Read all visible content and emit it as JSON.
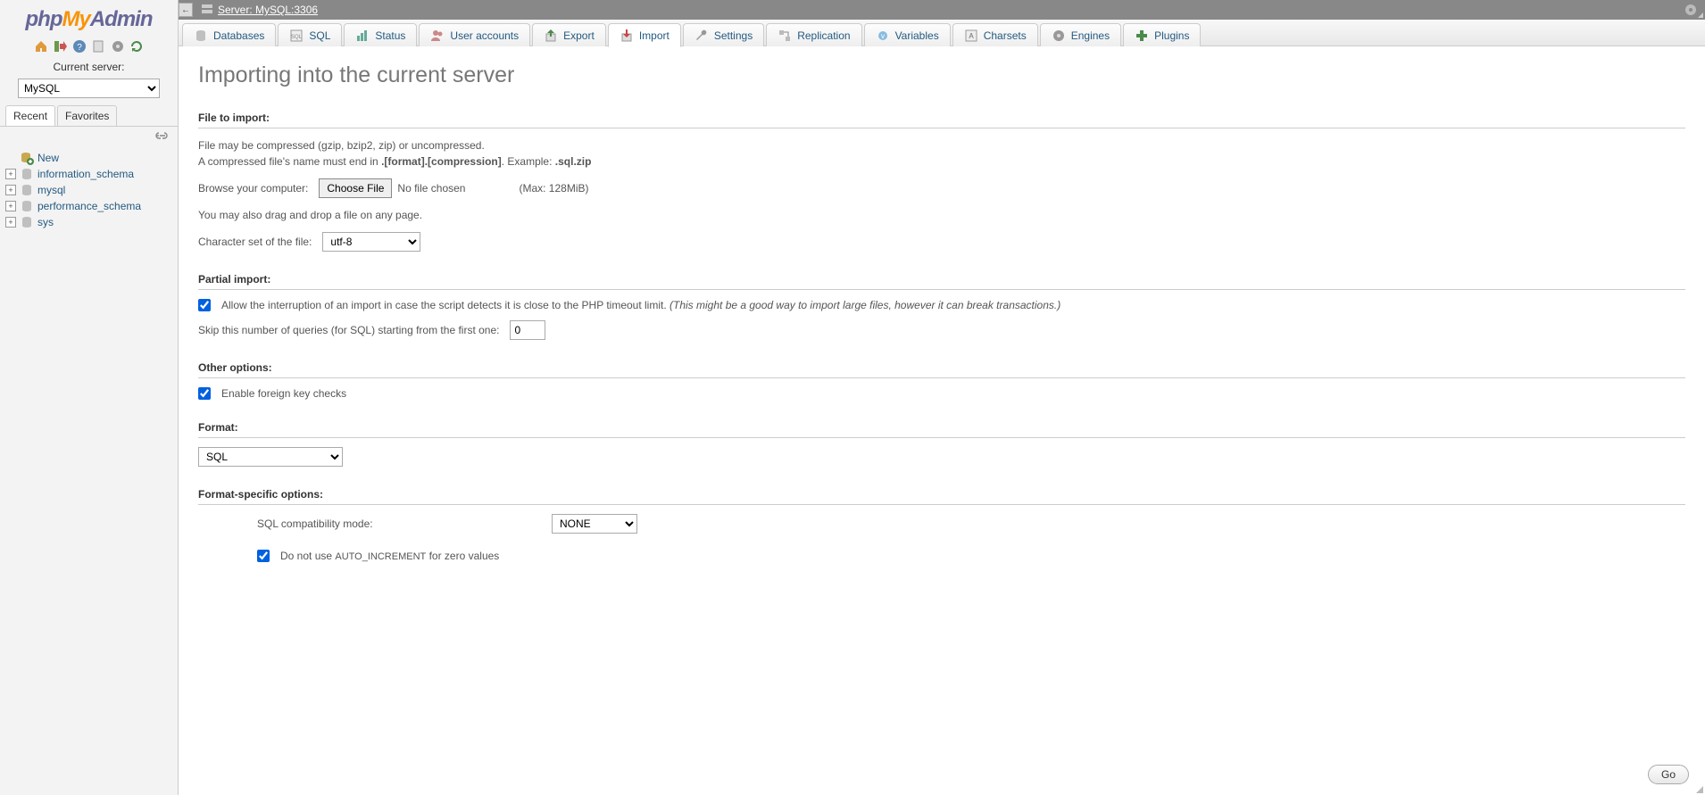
{
  "logo": {
    "p1": "php",
    "p2": "My",
    "p3": "Admin"
  },
  "sidebar": {
    "server_label": "Current server:",
    "server_select_value": "MySQL",
    "tabs": {
      "recent": "Recent",
      "favorites": "Favorites"
    },
    "new_label": "New",
    "databases": [
      "information_schema",
      "mysql",
      "performance_schema",
      "sys"
    ]
  },
  "topbar": {
    "server_text": "Server: MySQL:3306"
  },
  "main_tabs": [
    {
      "id": "databases",
      "label": "Databases"
    },
    {
      "id": "sql",
      "label": "SQL"
    },
    {
      "id": "status",
      "label": "Status"
    },
    {
      "id": "users",
      "label": "User accounts"
    },
    {
      "id": "export",
      "label": "Export"
    },
    {
      "id": "import",
      "label": "Import"
    },
    {
      "id": "settings",
      "label": "Settings"
    },
    {
      "id": "replication",
      "label": "Replication"
    },
    {
      "id": "variables",
      "label": "Variables"
    },
    {
      "id": "charsets",
      "label": "Charsets"
    },
    {
      "id": "engines",
      "label": "Engines"
    },
    {
      "id": "plugins",
      "label": "Plugins"
    }
  ],
  "page_title": "Importing into the current server",
  "file_import": {
    "title": "File to import:",
    "help1": "File may be compressed (gzip, bzip2, zip) or uncompressed.",
    "help2a": "A compressed file's name must end in ",
    "help2b": ".[format].[compression]",
    "help2c": ". Example: ",
    "help2d": ".sql.zip",
    "browse_label": "Browse your computer:",
    "choose_file_btn": "Choose File",
    "no_file": "No file chosen",
    "max": "(Max: 128MiB)",
    "drag_hint": "You may also drag and drop a file on any page.",
    "charset_label": "Character set of the file:",
    "charset_value": "utf-8"
  },
  "partial": {
    "title": "Partial import:",
    "allow_label": "Allow the interruption of an import in case the script detects it is close to the PHP timeout limit.",
    "allow_hint": "(This might be a good way to import large files, however it can break transactions.)",
    "skip_label": "Skip this number of queries (for SQL) starting from the first one:",
    "skip_value": "0"
  },
  "other": {
    "title": "Other options:",
    "fk_label": "Enable foreign key checks"
  },
  "format": {
    "title": "Format:",
    "value": "SQL"
  },
  "fso": {
    "title": "Format-specific options:",
    "compat_label": "SQL compatibility mode:",
    "compat_value": "NONE",
    "noauto_pre": "Do not use ",
    "noauto_code": "AUTO_INCREMENT",
    "noauto_post": " for zero values"
  },
  "go_btn": "Go"
}
